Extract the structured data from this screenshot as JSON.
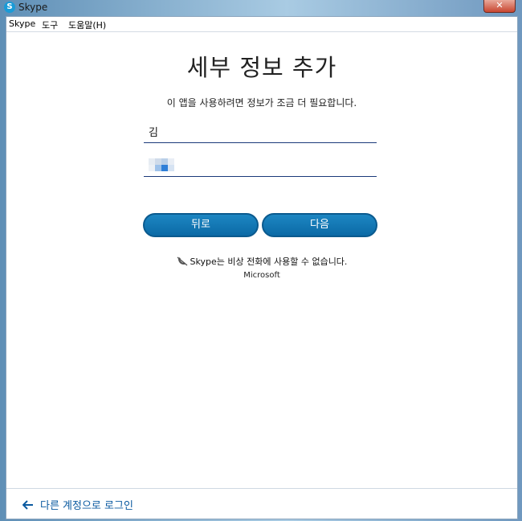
{
  "window": {
    "title": "Skype",
    "close_label": "✕"
  },
  "menu": {
    "items": [
      "Skype",
      "도구",
      "도움말(H)"
    ]
  },
  "page": {
    "heading": "세부 정보 추가",
    "subtext": "이 앱을 사용하려면 정보가 조금 더 필요합니다.",
    "last_name_value": "김",
    "first_name_value": ""
  },
  "buttons": {
    "back_label": "뒤로",
    "next_label": "다음"
  },
  "notice": {
    "emergency_text": "Skype는 비상 전화에 사용할 수 없습니다.",
    "brand": "Microsoft"
  },
  "footer": {
    "switch_account_label": "다른 계정으로 로그인"
  },
  "colors": {
    "accent": "#0b6aa6",
    "link": "#0b5aa0"
  },
  "icons": {
    "app": "skype-logo-icon",
    "close": "close-icon",
    "notice": "no-phone-icon",
    "back": "arrow-left-icon"
  }
}
